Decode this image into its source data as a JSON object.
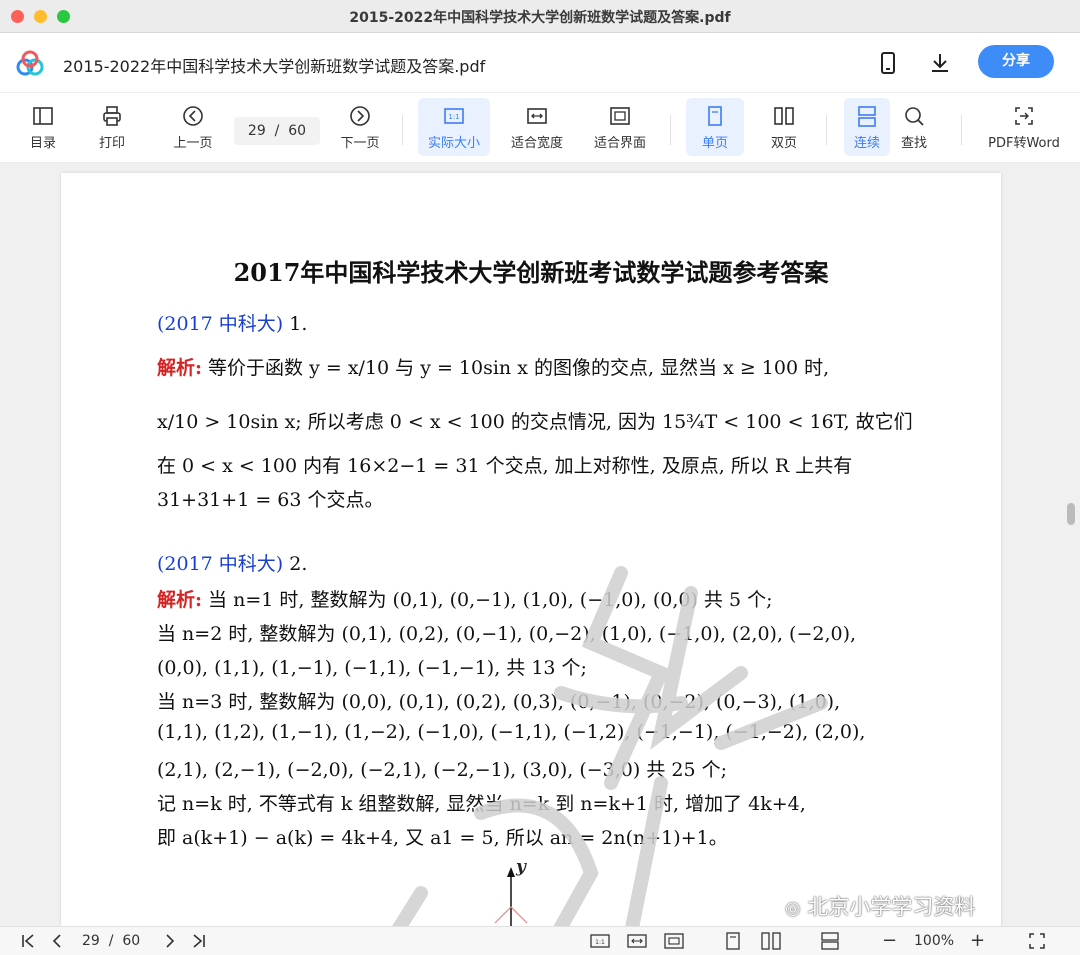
{
  "window": {
    "title": "2015-2022年中国科学技术大学创新班数学试题及答案.pdf"
  },
  "header": {
    "doc_title": "2015-2022年中国科学技术大学创新班数学试题及答案.pdf",
    "share_label": "分享",
    "accent": "#3d8cf7"
  },
  "toolbar": {
    "toc": "目录",
    "print": "打印",
    "prev": "上一页",
    "page_current": "29",
    "page_sep": "/",
    "page_total": "60",
    "next": "下一页",
    "actual_size": "实际大小",
    "fit_width": "适合宽度",
    "fit_page": "适合界面",
    "single_page": "单页",
    "double_page": "双页",
    "continuous": "连续",
    "find": "查找",
    "pdf_to_word": "PDF转Word"
  },
  "page": {
    "title": "2017年中国科学技术大学创新班考试数学试题参考答案",
    "q1_tag": "(2017 中科大)",
    "q1_num": " 1.",
    "q1_label": "解析:",
    "q1_l1": " 等价于函数 y = x/10 与 y = 10sin x 的图像的交点, 显然当 x ≥ 100 时,",
    "q1_l2": "x/10 > 10sin x; 所以考虑 0 < x < 100 的交点情况, 因为 15¾T < 100 < 16T, 故它们",
    "q1_l3": "在 0 < x < 100 内有 16×2−1 = 31 个交点, 加上对称性, 及原点, 所以 R 上共有",
    "q1_l4": "31+31+1 = 63 个交点。",
    "q2_tag": "(2017 中科大)",
    "q2_num": " 2.",
    "q2_label": "解析:",
    "q2_l1": " 当 n=1 时, 整数解为 (0,1), (0,−1), (1,0), (−1,0), (0,0) 共 5 个;",
    "q2_l2": "当 n=2 时, 整数解为 (0,1), (0,2), (0,−1), (0,−2), (1,0), (−1,0), (2,0), (−2,0),",
    "q2_l3": "(0,0), (1,1), (1,−1), (−1,1), (−1,−1), 共 13 个;",
    "q2_l4": "当 n=3 时, 整数解为 (0,0), (0,1), (0,2), (0,3), (0,−1), (0,−2), (0,−3), (1,0),",
    "q2_l5": "(1,1), (1,2), (1,−1), (1,−2), (−1,0), (−1,1), (−1,2), (−1,−1), (−1,−2), (2,0),",
    "q2_l6": "(2,1), (2,−1), (−2,0), (−2,1), (−2,−1), (3,0), (−3,0) 共 25 个;",
    "q2_l7": "记 n=k 时, 不等式有 k 组整数解, 显然当 n=k 到 n=k+1 时, 增加了 4k+4,",
    "q2_l8": "即 a(k+1) − a(k) = 4k+4, 又 a1 = 5, 所以 an = 2n(n+1)+1。",
    "axis_label": "y",
    "wechat_watermark": "北京小学学习资料"
  },
  "statusbar": {
    "page_current": "29",
    "page_sep": "/",
    "page_total": "60",
    "zoom": "100%",
    "minus": "−",
    "plus": "+"
  }
}
